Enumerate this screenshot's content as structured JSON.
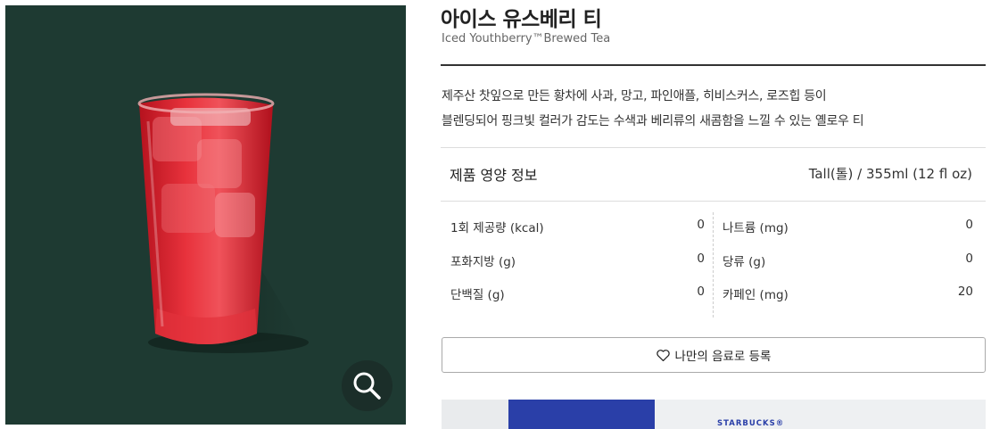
{
  "product": {
    "name_ko": "아이스 유스베리 티",
    "name_en": "Iced Youthberry™Brewed Tea",
    "description_line1": "제주산 찻잎으로 만든 황차에 사과, 망고, 파인애플, 히비스커스, 로즈힙 등이",
    "description_line2": "블렌딩되어 핑크빛 컬러가 감도는 수색과 베리류의 새콤함을 느낄 수 있는 옐로우 티",
    "image_icon": "iced-red-tea-cup",
    "zoom_icon": "magnifier-icon"
  },
  "nutrition": {
    "heading": "제품 영양 정보",
    "size": "Tall(톨) / 355ml (12 fl oz)",
    "left": [
      {
        "label": "1회 제공량 (kcal)",
        "value": "0"
      },
      {
        "label": "포화지방 (g)",
        "value": "0"
      },
      {
        "label": "단백질 (g)",
        "value": "0"
      }
    ],
    "right": [
      {
        "label": "나트륨 (mg)",
        "value": "0"
      },
      {
        "label": "당류 (g)",
        "value": "0"
      },
      {
        "label": "카페인 (mg)",
        "value": "20"
      }
    ]
  },
  "actions": {
    "favorite_label": "나만의 음료로 등록",
    "favorite_icon": "heart-icon"
  },
  "banner": {
    "brand": "STARBUCKS®"
  },
  "colors": {
    "photo_bg": "#1e3a32",
    "zoom_bg": "#1b2e29",
    "drink": "#d8242f",
    "banner_blue": "#2a3fa8"
  }
}
